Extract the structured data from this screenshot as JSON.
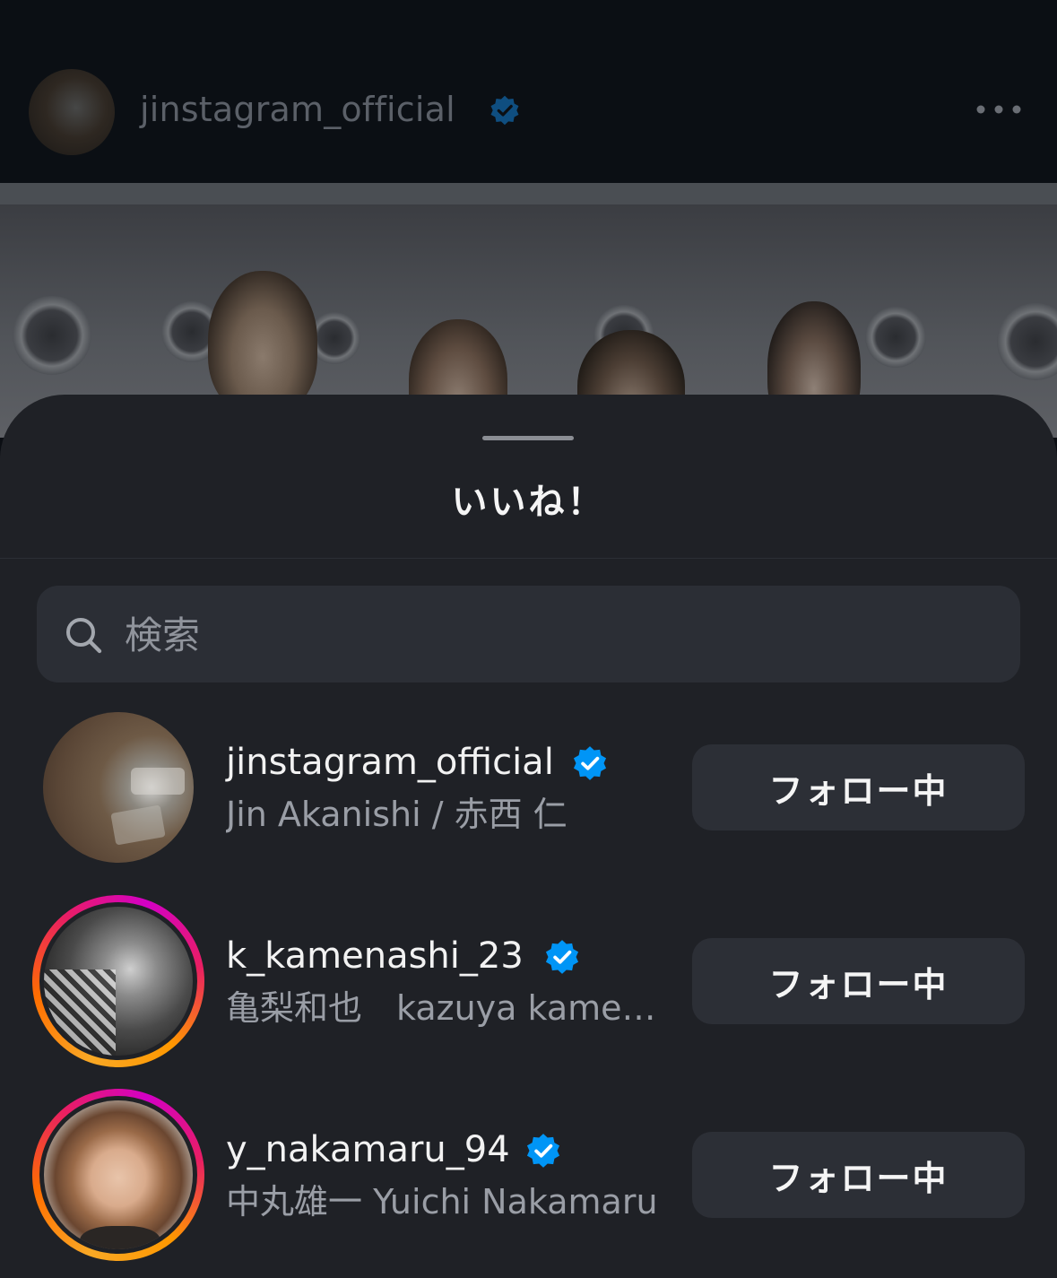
{
  "post": {
    "username": "jinstagram_official",
    "verified_icon": "verified-badge-icon",
    "more_icon": "more-horizontal-icon"
  },
  "sheet": {
    "title": "いいね！",
    "search": {
      "placeholder": "検索",
      "value": ""
    }
  },
  "likers": [
    {
      "username": "jinstagram_official",
      "full_name": "Jin Akanishi / 赤西 仁",
      "verified": true,
      "story_ring": false,
      "button": "フォロー中"
    },
    {
      "username": "k_kamenashi_23",
      "full_name": "亀梨和也　kazuya kamenashi",
      "verified": true,
      "story_ring": true,
      "button": "フォロー中"
    },
    {
      "username": "y_nakamaru_94",
      "full_name": "中丸雄一 Yuichi Nakamaru",
      "verified": true,
      "story_ring": true,
      "button": "フォロー中"
    }
  ],
  "colors": {
    "verified_blue": "#0095f6",
    "sheet_bg": "#1f2126",
    "button_bg": "#2c2f36"
  }
}
